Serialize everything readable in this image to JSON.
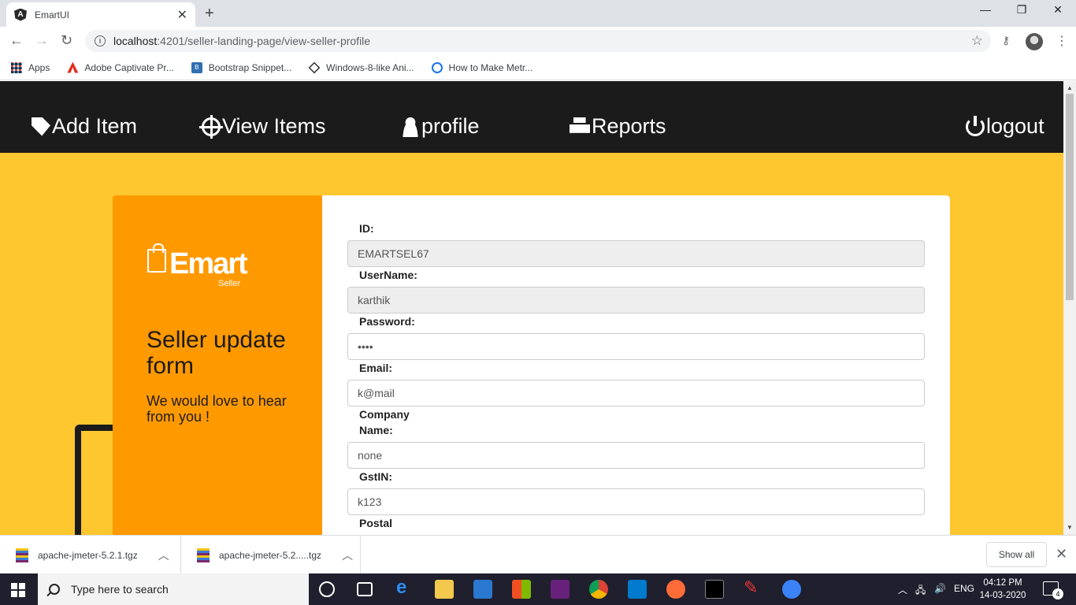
{
  "browser": {
    "tab_title": "EmartUI",
    "url_host": "localhost",
    "url_path": ":4201/seller-landing-page/view-seller-profile",
    "bookmarks": [
      {
        "label": "Apps",
        "icon": "apps-icon"
      },
      {
        "label": "Adobe Captivate Pr...",
        "icon": "adobe-icon"
      },
      {
        "label": "Bootstrap Snippet...",
        "icon": "bootstrap-icon"
      },
      {
        "label": "Windows-8-like Ani...",
        "icon": "windows-icon"
      },
      {
        "label": "How to Make Metr...",
        "icon": "metro-icon"
      }
    ]
  },
  "navbar": {
    "items": [
      {
        "label": "Add Item",
        "icon": "tag-icon"
      },
      {
        "label": "View Items",
        "icon": "crosshair-icon"
      },
      {
        "label": "profile",
        "icon": "user-icon"
      },
      {
        "label": "Reports",
        "icon": "print-icon"
      },
      {
        "label": "logout",
        "icon": "power-icon"
      }
    ]
  },
  "sidebar": {
    "logo_text": "Emart",
    "logo_sub": "Seller",
    "heading": "Seller update form",
    "subheading": "We would love to hear from you !"
  },
  "form": {
    "fields": [
      {
        "label": "ID:",
        "value": "EMARTSEL67",
        "readonly": true
      },
      {
        "label": "UserName:",
        "value": "karthik",
        "readonly": true
      },
      {
        "label": "Password:",
        "value": "••••",
        "readonly": false
      },
      {
        "label": "Email:",
        "value": "k@mail",
        "readonly": false
      },
      {
        "label": "Company",
        "label2": "Name:",
        "value": "none",
        "readonly": false
      },
      {
        "label": "GstIN:",
        "value": "k123",
        "readonly": false
      },
      {
        "label": "Postal"
      }
    ]
  },
  "downloads": {
    "items": [
      {
        "name": "apache-jmeter-5.2.1.tgz"
      },
      {
        "name": "apache-jmeter-5.2.....tgz"
      }
    ],
    "show_all": "Show all"
  },
  "taskbar": {
    "search_placeholder": "Type here to search",
    "lang": "ENG",
    "time": "04:12 PM",
    "date": "14-03-2020",
    "notification_count": "4"
  },
  "colors": {
    "page_bg": "#fec72f",
    "navbar_bg": "#1b1b1b",
    "card_left_bg": "#ff9900"
  }
}
